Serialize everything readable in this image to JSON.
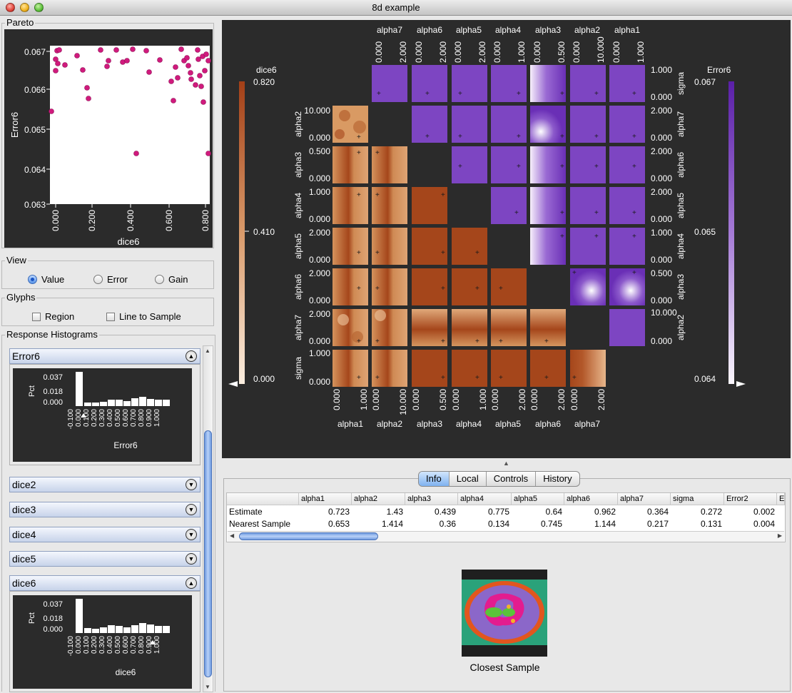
{
  "window": {
    "title": "8d example"
  },
  "pareto": {
    "title": "Pareto",
    "xlabel": "dice6",
    "ylabel": "Error6",
    "xticks": [
      "0.000",
      "0.200",
      "0.400",
      "0.600",
      "0.800"
    ],
    "yticks": [
      "0.067",
      "0.066",
      "0.065",
      "0.064",
      "0.063"
    ]
  },
  "view": {
    "title": "View",
    "options": [
      "Value",
      "Error",
      "Gain"
    ],
    "selected": "Value"
  },
  "glyphs": {
    "title": "Glyphs",
    "region": "Region",
    "line_to_sample": "Line to Sample"
  },
  "histograms": {
    "title": "Response Histograms",
    "panels": [
      {
        "name": "Error6",
        "expanded": true
      },
      {
        "name": "dice2",
        "expanded": false
      },
      {
        "name": "dice3",
        "expanded": false
      },
      {
        "name": "dice4",
        "expanded": false
      },
      {
        "name": "dice5",
        "expanded": false
      },
      {
        "name": "dice6",
        "expanded": true
      }
    ],
    "ylabel": "Pct",
    "yticks": [
      "0.037",
      "0.018",
      "0.000"
    ],
    "xticks": [
      "-0.100",
      "0.000",
      "0.100",
      "0.200",
      "0.300",
      "0.400",
      "0.500",
      "0.600",
      "0.700",
      "0.800",
      "0.900",
      "1.000"
    ],
    "error6_label": "Error6",
    "dice6_label": "dice6"
  },
  "matrix": {
    "params": [
      "alpha1",
      "alpha2",
      "alpha3",
      "alpha4",
      "alpha5",
      "alpha6",
      "alpha7",
      "sigma"
    ],
    "ranges": {
      "alpha1": [
        "0.000",
        "1.000"
      ],
      "alpha2": [
        "0.000",
        "10.000"
      ],
      "alpha3": [
        "0.000",
        "0.500"
      ],
      "alpha4": [
        "0.000",
        "1.000"
      ],
      "alpha5": [
        "0.000",
        "2.000"
      ],
      "alpha6": [
        "0.000",
        "2.000"
      ],
      "alpha7": [
        "0.000",
        "2.000"
      ],
      "sigma": [
        "0.000",
        "1.000"
      ]
    },
    "left_scale": {
      "label": "dice6",
      "max": "0.820",
      "mid": "0.410",
      "min": "0.000"
    },
    "right_scale": {
      "label": "Error6",
      "max": "0.067",
      "mid": "0.065",
      "min": "0.064"
    }
  },
  "tabs": [
    "Info",
    "Local",
    "Controls",
    "History"
  ],
  "selected_tab": "Info",
  "info_table": {
    "columns": [
      "",
      "alpha1",
      "alpha2",
      "alpha3",
      "alpha4",
      "alpha5",
      "alpha6",
      "alpha7",
      "sigma",
      "Error2",
      "E"
    ],
    "rows": [
      {
        "label": "Estimate",
        "values": [
          "0.723",
          "1.43",
          "0.439",
          "0.775",
          "0.64",
          "0.962",
          "0.364",
          "0.272",
          "0.002"
        ]
      },
      {
        "label": "Nearest Sample",
        "values": [
          "0.653",
          "1.414",
          "0.36",
          "0.134",
          "0.745",
          "1.144",
          "0.217",
          "0.131",
          "0.004"
        ]
      }
    ]
  },
  "closest_sample": {
    "label": "Closest Sample"
  },
  "colors": {
    "dice_max": "#a33f17",
    "dice_min": "#fbeee0",
    "error_max": "#5a1fa8",
    "error_min": "#faf6fd",
    "pareto_point": "#d01a7d",
    "panel_bg": "#2b2b2b"
  }
}
